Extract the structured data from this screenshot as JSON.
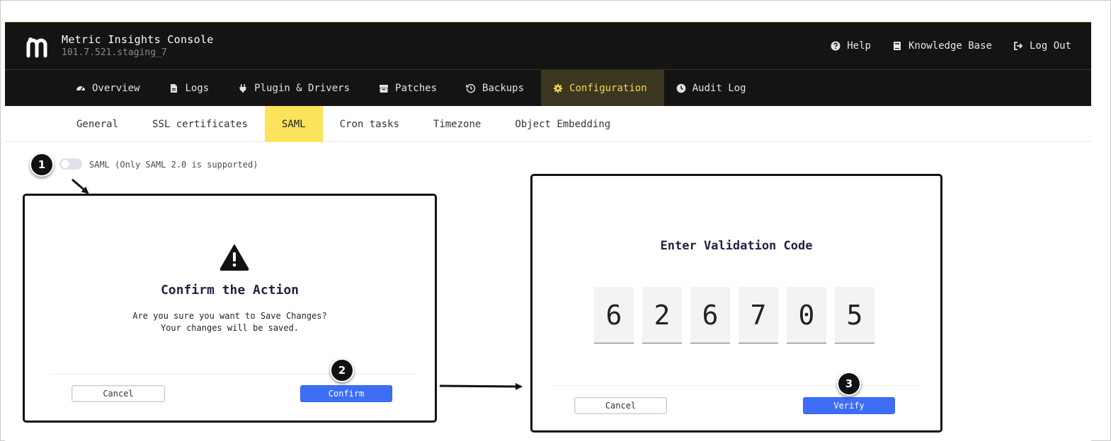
{
  "header": {
    "title": "Metric Insights Console",
    "version": "101.7.521.staging_7",
    "links": [
      {
        "label": "Help",
        "icon": "question-circle-icon"
      },
      {
        "label": "Knowledge Base",
        "icon": "book-icon"
      },
      {
        "label": "Log Out",
        "icon": "sign-out-icon"
      }
    ]
  },
  "main_nav": {
    "tabs": [
      {
        "label": "Overview",
        "icon": "dashboard-icon"
      },
      {
        "label": "Logs",
        "icon": "file-icon"
      },
      {
        "label": "Plugin & Drivers",
        "icon": "plug-icon"
      },
      {
        "label": "Patches",
        "icon": "box-icon"
      },
      {
        "label": "Backups",
        "icon": "history-icon"
      },
      {
        "label": "Configuration",
        "icon": "gear-icon",
        "active": true
      },
      {
        "label": "Audit Log",
        "icon": "clock-icon"
      }
    ]
  },
  "sub_nav": {
    "tabs": [
      {
        "label": "General"
      },
      {
        "label": "SSL certificates"
      },
      {
        "label": "SAML",
        "active": true
      },
      {
        "label": "Cron tasks"
      },
      {
        "label": "Timezone"
      },
      {
        "label": "Object Embedding"
      }
    ]
  },
  "saml": {
    "toggle_label": "SAML (Only SAML 2.0 is supported)",
    "enabled": false
  },
  "steps": [
    "1",
    "2",
    "3"
  ],
  "confirm_modal": {
    "title": "Confirm the Action",
    "line1": "Are you sure you want to Save Changes?",
    "line2": "Your changes will be saved.",
    "cancel_label": "Cancel",
    "confirm_label": "Confirm"
  },
  "validation_modal": {
    "title": "Enter Validation Code",
    "digits": [
      "6",
      "2",
      "6",
      "7",
      "0",
      "5"
    ],
    "cancel_label": "Cancel",
    "verify_label": "Verify"
  },
  "colors": {
    "header_bg": "#141414",
    "active_tab_text": "#f6d84a",
    "active_subtab_bg": "#fce35c",
    "primary_button": "#3d6ef5"
  }
}
